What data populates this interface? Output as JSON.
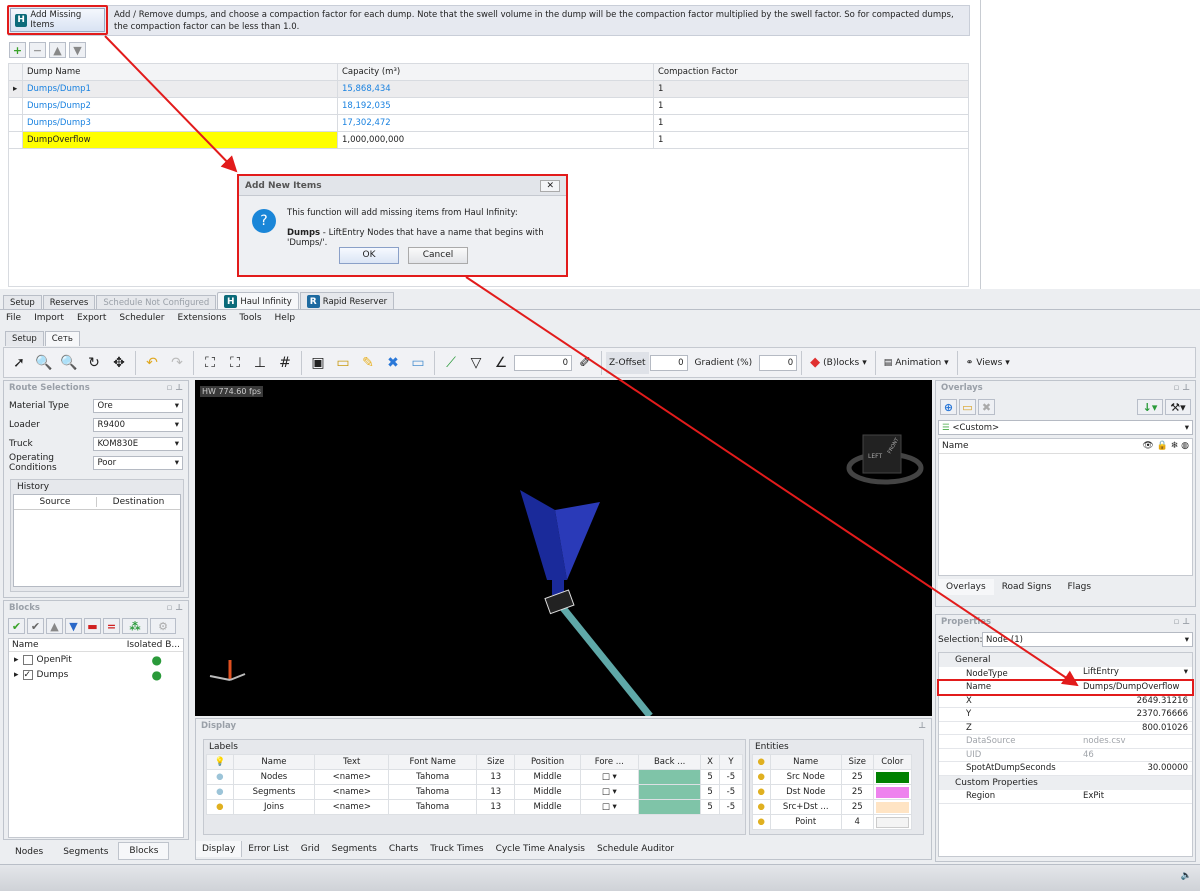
{
  "top": {
    "add_missing_label": "Add Missing Items",
    "description": "Add / Remove dumps, and choose a compaction factor for each dump. Note that the swell volume in the dump will be the compaction factor multiplied by the swell factor. So for compacted dumps, the compaction factor can be less than 1.0.",
    "columns": [
      "Dump Name",
      "Capacity (m³)",
      "Compaction Factor"
    ],
    "rows": [
      {
        "name": "Dumps/Dump1",
        "capacity": "15,868,434",
        "factor": "1"
      },
      {
        "name": "Dumps/Dump2",
        "capacity": "18,192,035",
        "factor": "1"
      },
      {
        "name": "Dumps/Dump3",
        "capacity": "17,302,472",
        "factor": "1"
      },
      {
        "name": "DumpOverflow",
        "capacity": "1,000,000,000",
        "factor": "1"
      }
    ]
  },
  "dialog": {
    "title": "Add New Items",
    "message": "This function will add missing items from Haul Infinity:",
    "detail_bold": "Dumps",
    "detail": " - LiftEntry Nodes that have a name that begins with 'Dumps/'.",
    "ok": "OK",
    "cancel": "Cancel"
  },
  "app_tabs": [
    "Setup",
    "Reserves",
    "Schedule Not Configured",
    "Haul Infinity",
    "Rapid Reserver"
  ],
  "menu": [
    "File",
    "Import",
    "Export",
    "Scheduler",
    "Extensions",
    "Tools",
    "Help"
  ],
  "sub_tabs": [
    "Setup",
    "Сеть"
  ],
  "toolbar": {
    "spin1": "0",
    "z_offset": "Z-Offset",
    "z_value": "0",
    "gradient_label": "Gradient (%)",
    "gradient_value": "0",
    "blocks": "(B)locks",
    "animation": "Animation",
    "views": "Views"
  },
  "route": {
    "title": "Route Selections",
    "fields": [
      {
        "label": "Material Type",
        "value": "Ore"
      },
      {
        "label": "Loader",
        "value": "R9400"
      },
      {
        "label": "Truck",
        "value": "KOM830E"
      },
      {
        "label": "Operating Conditions",
        "value": "Poor"
      }
    ],
    "history": "History",
    "history_cols": [
      "Source",
      "Destination"
    ]
  },
  "blocks": {
    "title": "Blocks",
    "cols": [
      "Name",
      "Isolated B..."
    ],
    "items": [
      {
        "name": "OpenPit",
        "checked": false
      },
      {
        "name": "Dumps",
        "checked": true
      }
    ]
  },
  "left_tabs": [
    "Nodes",
    "Segments",
    "Blocks"
  ],
  "viewport": {
    "fps": "HW 774.60 fps",
    "cube_left": "LEFT",
    "cube_front": "FRONT"
  },
  "display": {
    "title": "Display",
    "labels_title": "Labels",
    "label_cols": [
      "Name",
      "Text",
      "Font Name",
      "Size",
      "Position",
      "Fore ...",
      "Back ...",
      "X",
      "Y"
    ],
    "label_rows": [
      {
        "name": "Nodes",
        "text": "<name>",
        "font": "Tahoma",
        "size": "13",
        "pos": "Middle",
        "x": "5",
        "y": "-5",
        "on": false
      },
      {
        "name": "Segments",
        "text": "<name>",
        "font": "Tahoma",
        "size": "13",
        "pos": "Middle",
        "x": "5",
        "y": "-5",
        "on": false
      },
      {
        "name": "Joins",
        "text": "<name>",
        "font": "Tahoma",
        "size": "13",
        "pos": "Middle",
        "x": "5",
        "y": "-5",
        "on": true
      }
    ],
    "entities_title": "Entities",
    "entity_cols": [
      "Name",
      "Size",
      "Color"
    ],
    "entity_rows": [
      {
        "name": "Src Node",
        "size": "25",
        "color": "#008000"
      },
      {
        "name": "Dst Node",
        "size": "25",
        "color": "#ee82ee"
      },
      {
        "name": "Src+Dst ...",
        "size": "25",
        "color": "#ffe4c4"
      },
      {
        "name": "Point",
        "size": "4",
        "color": "#f4f4f4"
      }
    ]
  },
  "bottom_tabs": [
    "Display",
    "Error List",
    "Grid",
    "Segments",
    "Charts",
    "Truck Times",
    "Cycle Time Analysis",
    "Schedule Auditor"
  ],
  "overlays": {
    "title": "Overlays",
    "preset": "<Custom>",
    "col_name": "Name",
    "tabs": [
      "Overlays",
      "Road Signs",
      "Flags"
    ]
  },
  "properties": {
    "title": "Properties",
    "selection_label": "Selection:",
    "selection": "Node (1)",
    "general": "General",
    "custom": "Custom Properties",
    "rows": [
      {
        "k": "NodeType",
        "v": "LiftEntry"
      },
      {
        "k": "Name",
        "v": "Dumps/DumpOverflow"
      },
      {
        "k": "X",
        "v": "2649.31216"
      },
      {
        "k": "Y",
        "v": "2370.76666"
      },
      {
        "k": "Z",
        "v": "800.01026"
      },
      {
        "k": "DataSource",
        "v": "nodes.csv"
      },
      {
        "k": "UID",
        "v": "46"
      },
      {
        "k": "SpotAtDumpSeconds",
        "v": "30.00000"
      }
    ],
    "region_k": "Region",
    "region_v": "ExPit"
  },
  "colors": {
    "highlight": "#e21b1b",
    "yellow": "#ffff00",
    "link": "#1a82e0"
  }
}
